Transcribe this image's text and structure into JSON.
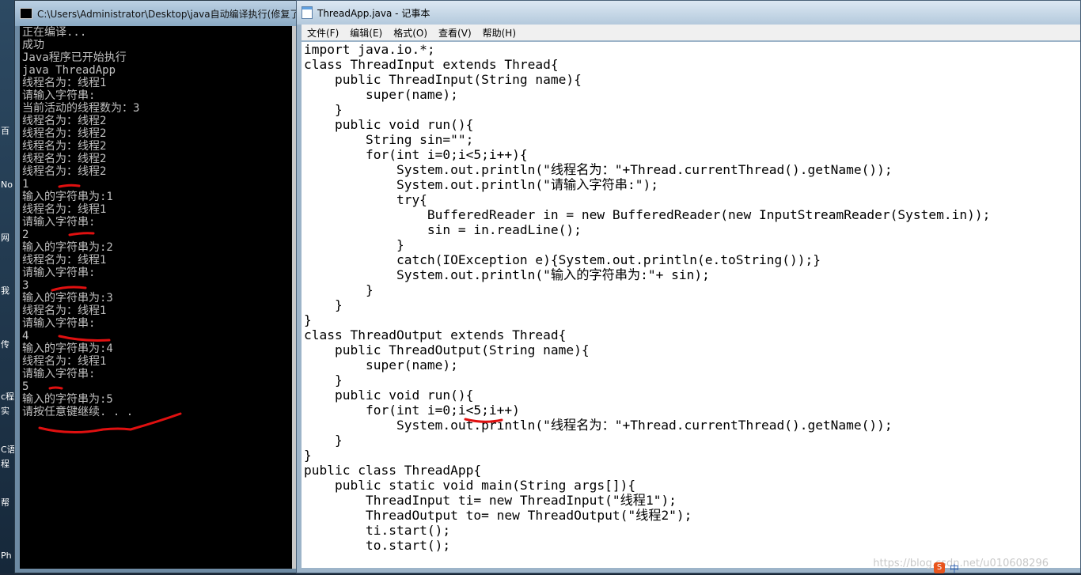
{
  "desktop": {
    "labels": [
      "百",
      "No",
      "网",
      "我",
      "传",
      "c程",
      "实",
      "C语",
      "程",
      "帮",
      "Ph"
    ]
  },
  "console": {
    "title": "C:\\Users\\Administrator\\Desktop\\java自动编译执行(修复了",
    "lines": [
      "正在编译...",
      "成功",
      "Java程序已开始执行",
      "java ThreadApp",
      "线程名为：线程1",
      "请输入字符串:",
      "当前活动的线程数为：3",
      "线程名为：线程2",
      "线程名为：线程2",
      "线程名为：线程2",
      "线程名为：线程2",
      "线程名为：线程2",
      "1",
      "输入的字符串为:1",
      "线程名为：线程1",
      "请输入字符串:",
      "2",
      "输入的字符串为:2",
      "线程名为：线程1",
      "请输入字符串:",
      "3",
      "输入的字符串为:3",
      "线程名为：线程1",
      "请输入字符串:",
      "4",
      "输入的字符串为:4",
      "线程名为：线程1",
      "请输入字符串:",
      "5",
      "输入的字符串为:5",
      "请按任意键继续. . ."
    ]
  },
  "notepad": {
    "title": "ThreadApp.java - 记事本",
    "menus": [
      "文件(F)",
      "编辑(E)",
      "格式(O)",
      "查看(V)",
      "帮助(H)"
    ],
    "code": [
      "import java.io.*;",
      "class ThreadInput extends Thread{",
      "    public ThreadInput(String name){",
      "        super(name);",
      "    }",
      "    public void run(){",
      "        String sin=\"\";",
      "        for(int i=0;i<5;i++){",
      "            System.out.println(\"线程名为：\"+Thread.currentThread().getName());",
      "            System.out.println(\"请输入字符串:\");",
      "            try{",
      "                BufferedReader in = new BufferedReader(new InputStreamReader(System.in));",
      "                sin = in.readLine();",
      "            }",
      "            catch(IOException e){System.out.println(e.toString());}",
      "            System.out.println(\"输入的字符串为:\"+ sin);",
      "        }",
      "    }",
      "}",
      "class ThreadOutput extends Thread{",
      "    public ThreadOutput(String name){",
      "        super(name);",
      "    }",
      "    public void run(){",
      "        for(int i=0;i<5;i++)",
      "            System.out.println(\"线程名为：\"+Thread.currentThread().getName());",
      "    }",
      "}",
      "public class ThreadApp{",
      "    public static void main(String args[]){",
      "        ThreadInput ti= new ThreadInput(\"线程1\");",
      "        ThreadOutput to= new ThreadOutput(\"线程2\");",
      "        ti.start();",
      "        to.start();"
    ]
  },
  "watermark": "https://blog.csdn.net/u010608296",
  "taskbar": {
    "ime_logo": "S",
    "ime_label": "中"
  },
  "colors": {
    "annotation": "#e01010",
    "console_text": "#c0c0c0",
    "console_bg": "#000000"
  }
}
